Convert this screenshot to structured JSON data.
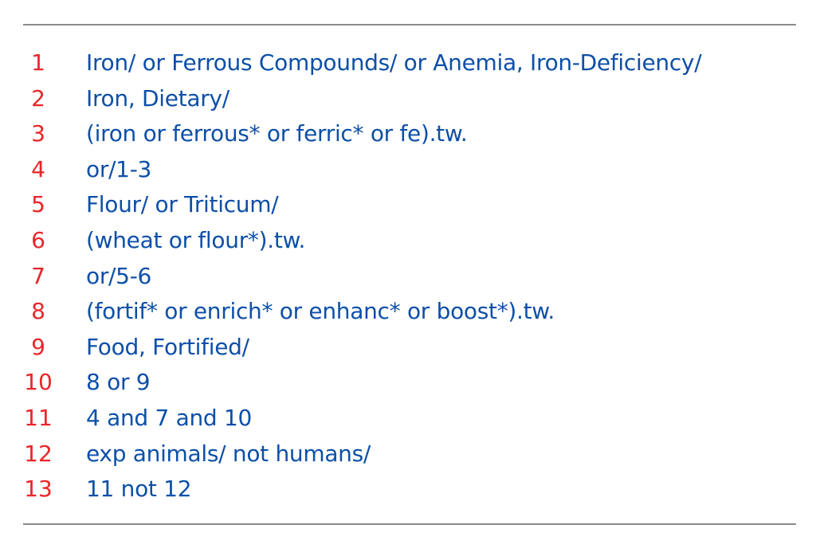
{
  "search_strategy": {
    "lines": [
      {
        "number": "1",
        "text": "Iron/ or Ferrous Compounds/ or Anemia, Iron-Deficiency/"
      },
      {
        "number": "2",
        "text": "Iron, Dietary/"
      },
      {
        "number": "3",
        "text": "(iron or ferrous* or ferric* or fe).tw."
      },
      {
        "number": "4",
        "text": "or/1-3"
      },
      {
        "number": "5",
        "text": "Flour/ or Triticum/"
      },
      {
        "number": "6",
        "text": "(wheat or flour*).tw."
      },
      {
        "number": "7",
        "text": "or/5-6"
      },
      {
        "number": "8",
        "text": "(fortif* or enrich* or enhanc* or boost*).tw."
      },
      {
        "number": "9",
        "text": "Food, Fortified/"
      },
      {
        "number": "10",
        "text": "8 or 9"
      },
      {
        "number": "11",
        "text": "4 and 7 and 10"
      },
      {
        "number": "12",
        "text": "exp animals/ not humans/"
      },
      {
        "number": "13",
        "text": "11 not 12"
      }
    ]
  },
  "colors": {
    "number": "#e8262a",
    "text": "#0d4fa8",
    "rule": "#8a8a8a"
  }
}
